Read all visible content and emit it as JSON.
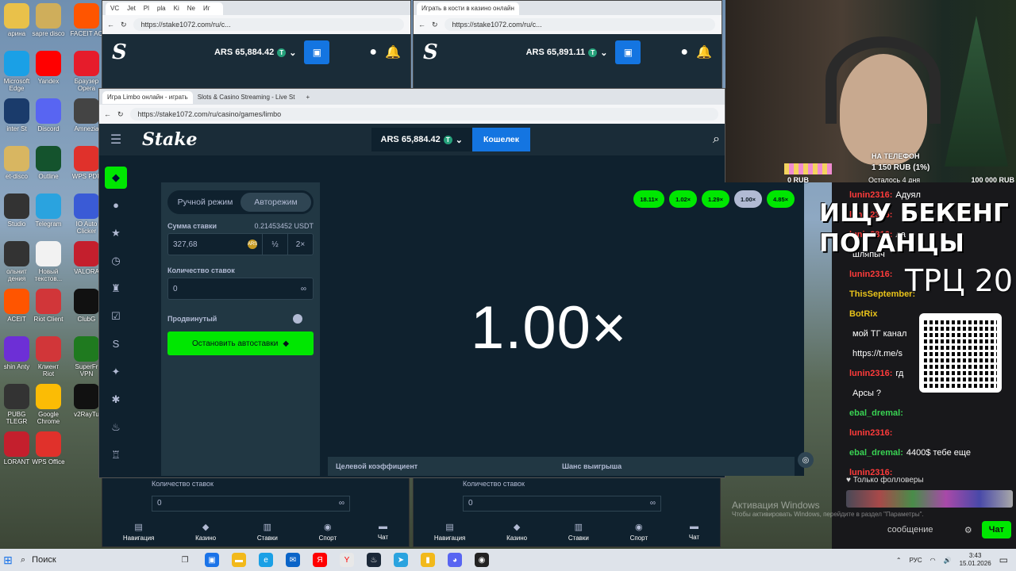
{
  "desktop_icons": [
    {
      "label": "арина",
      "color": "#e9c14a"
    },
    {
      "label": "sapre disco",
      "color": "#cfae5b"
    },
    {
      "label": "FACEIT AC",
      "color": "#ff5500"
    },
    {
      "label": "Microsoft Edge",
      "color": "#1aa0e6"
    },
    {
      "label": "Yandex",
      "color": "#ff0000"
    },
    {
      "label": "Браузер Opera",
      "color": "#e61c2b"
    },
    {
      "label": "inter St",
      "color": "#1a3b6b"
    },
    {
      "label": "Discord",
      "color": "#5865f2"
    },
    {
      "label": "Amnezia",
      "color": "#444"
    },
    {
      "label": "et-disco",
      "color": "#d8b661"
    },
    {
      "label": "Outline",
      "color": "#14532d"
    },
    {
      "label": "WPS PDF",
      "color": "#e0312b"
    },
    {
      "label": "Studio",
      "color": "#333"
    },
    {
      "label": "Telegram",
      "color": "#2aa3df"
    },
    {
      "label": "IO Auto Clicker",
      "color": "#3a5bd6"
    },
    {
      "label": "ольнит дения",
      "color": "#333"
    },
    {
      "label": "Новый текстов...",
      "color": "#f2f2f2"
    },
    {
      "label": "VALORA",
      "color": "#c41f2d"
    },
    {
      "label": "ACEIT",
      "color": "#ff5500"
    },
    {
      "label": "Riot Client",
      "color": "#d13639"
    },
    {
      "label": "ClubG",
      "color": "#111"
    },
    {
      "label": "shin Anty",
      "color": "#6d2fd6"
    },
    {
      "label": "Клиент Riot",
      "color": "#d13639"
    },
    {
      "label": "SuperFr VPN",
      "color": "#1f7a1f"
    },
    {
      "label": "PUBG TLEGR",
      "color": "#333"
    },
    {
      "label": "Google Chrome",
      "color": "#fbbc05"
    },
    {
      "label": "v2RayTu",
      "color": "#111"
    },
    {
      "label": "LORANT",
      "color": "#c41f2d"
    },
    {
      "label": "WPS Office",
      "color": "#e0312b"
    }
  ],
  "top_left_window": {
    "tabs": [
      "VC",
      "Jet",
      "Pl",
      "pla",
      "Ki",
      "Ne",
      "Иг"
    ],
    "url": "https://stake1072.com/ru/c...",
    "balance": "ARS 65,884.42"
  },
  "top_right_window": {
    "tab": "Играть в кости в казино онлайн",
    "url": "https://stake1072.com/ru/c...",
    "balance": "ARS 65,891.11"
  },
  "main_window": {
    "tabs": [
      "Игра Limbo онлайн - играть",
      "Slots & Casino Streaming - Live St"
    ],
    "url": "https://stake1072.com/ru/casino/games/limbo",
    "logo": "Stake",
    "balance": "ARS 65,884.42",
    "wallet_label": "Кошелек",
    "mode_manual": "Ручной режим",
    "mode_auto": "Авторежим",
    "bet_amount_label": "Сумма ставки",
    "bet_amount_usdt": "0.21453452 USDT",
    "bet_amount_value": "327,68",
    "half_label": "½",
    "double_label": "2×",
    "num_bets_label": "Количество ставок",
    "num_bets_value": "0",
    "advanced_label": "Продвинутый",
    "stop_autobet_label": "Остановить автоставки",
    "recent_results": [
      "18.11×",
      "1.02×",
      "1.29×",
      "1.00×",
      "4.85×"
    ],
    "recent_result_colors": [
      "#00e701",
      "#00e701",
      "#00e701",
      "#b1bad3",
      "#00e701"
    ],
    "multiplier": "1.00×",
    "target_multiplier_label": "Целевой коэффициент",
    "win_chance_label": "Шанс выигрыша"
  },
  "lower_windows": {
    "num_bets_label": "Количество ставок",
    "num_bets_value": "0",
    "nav": [
      "Навигация",
      "Казино",
      "Ставки",
      "Спорт",
      "Чат"
    ]
  },
  "stream": {
    "donation_name": "НА ТЕЛЕФОН",
    "donation_amount": "1 150 RUB (1%)",
    "donation_left": "Осталось 4 дня",
    "donation_goal": "100 000 RUB",
    "donation_start": "0 RUB",
    "overlay_line1": "ИЩУ БЕКЕНГ",
    "overlay_line2": "ПОГАНЦЫ",
    "overlay_line3": "ТРЦ 20",
    "chat": [
      {
        "user": "lunin2316:",
        "text": "Адуял",
        "color": "#ff3b3b"
      },
      {
        "user": "lunin2316:",
        "text": "",
        "color": "#ff3b3b"
      },
      {
        "user": "lunin2316:",
        "text": "ла",
        "color": "#ff3b3b"
      },
      {
        "user": "",
        "text": "шляпыч",
        "color": "#ff3b3b"
      },
      {
        "user": "lunin2316:",
        "text": "",
        "color": "#ff3b3b"
      },
      {
        "user": "ThisSeptember:",
        "text": "",
        "color": "#e8c21a"
      },
      {
        "user": "BotRix",
        "text": "",
        "color": "#e8c21a"
      },
      {
        "user": "",
        "text": "мой ТГ канал",
        "color": "#ff3b3b"
      },
      {
        "user": "",
        "text": "https://t.me/s",
        "color": "#ff3b3b"
      },
      {
        "user": "lunin2316:",
        "text": "гд",
        "color": "#ff3b3b"
      },
      {
        "user": "",
        "text": "Арсы ?",
        "color": "#ff3b3b"
      },
      {
        "user": "ebal_dremal:",
        "text": "",
        "color": "#39d353"
      },
      {
        "user": "lunin2316:",
        "text": "",
        "color": "#ff3b3b"
      },
      {
        "user": "ebal_dremal:",
        "text": "4400$ тебе еще",
        "color": "#39d353"
      },
      {
        "user": "lunin2316:",
        "text": "",
        "color": "#ff3b3b"
      }
    ],
    "followers_only": "Только фолловеры",
    "chat_placeholder": "сообщение",
    "chat_button": "Чат",
    "activation_title": "Активация Windows",
    "activation_sub": "Чтобы активировать Windows, перейдите в раздел \"Параметры\"."
  },
  "taskbar": {
    "search": "Поиск",
    "lang": "РУС",
    "time": "3:43",
    "date": "15.01.2026"
  }
}
